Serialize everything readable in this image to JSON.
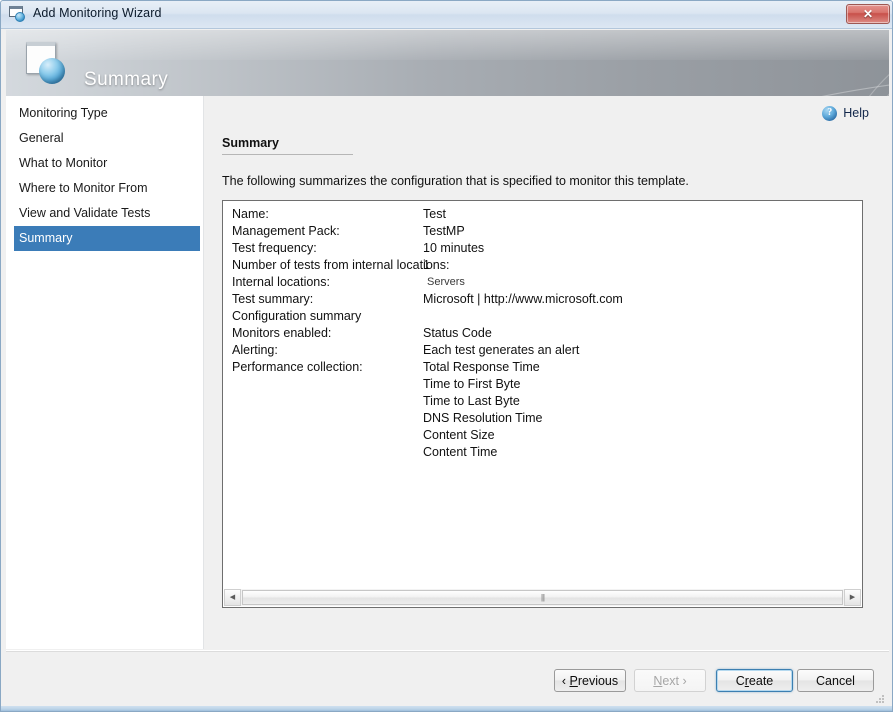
{
  "window": {
    "title": "Add Monitoring Wizard",
    "close_label": "✕",
    "icon": "window-globe-icon"
  },
  "header": {
    "title": "Summary",
    "icon": "page-globe-icon"
  },
  "sidebar": {
    "items": [
      {
        "label": "Monitoring Type",
        "selected": false
      },
      {
        "label": "General",
        "selected": false
      },
      {
        "label": "What to Monitor",
        "selected": false
      },
      {
        "label": "Where to Monitor From",
        "selected": false
      },
      {
        "label": "View and Validate Tests",
        "selected": false
      },
      {
        "label": "Summary",
        "selected": true
      }
    ]
  },
  "content": {
    "help_label": "Help",
    "help_glyph": "?",
    "section_heading": "Summary",
    "intro_text": "The following summarizes the configuration that is specified to monitor this template.",
    "rows": [
      {
        "label": "Name:",
        "value": "Test",
        "small": false
      },
      {
        "label": "Management Pack:",
        "value": "TestMP",
        "small": false
      },
      {
        "label": "Test frequency:",
        "value": "10 minutes",
        "small": false
      },
      {
        "label": "Number of tests from internal locations:",
        "value": "1",
        "small": false
      },
      {
        "label": "Internal locations:",
        "value": "Servers",
        "small": true
      },
      {
        "label": "Test summary:",
        "value": "Microsoft | http://www.microsoft.com",
        "small": false
      },
      {
        "label": "Configuration summary",
        "value": "",
        "small": false
      },
      {
        "label": "Monitors enabled:",
        "value": "Status Code",
        "small": false
      },
      {
        "label": "Alerting:",
        "value": "Each test generates an alert",
        "small": false
      },
      {
        "label": "Performance collection:",
        "value": "Total Response Time",
        "small": false
      },
      {
        "label": "",
        "value": "Time to First Byte",
        "small": false
      },
      {
        "label": "",
        "value": "Time to Last Byte",
        "small": false
      },
      {
        "label": "",
        "value": "DNS Resolution Time",
        "small": false
      },
      {
        "label": "",
        "value": "Content Size",
        "small": false
      },
      {
        "label": "",
        "value": "Content Time",
        "small": false
      }
    ],
    "scrollbar": {
      "left_arrow": "◀",
      "right_arrow": "▶",
      "grip": "|||"
    }
  },
  "footer": {
    "buttons": [
      {
        "name": "previous",
        "prefix": "‹ ",
        "accel": "P",
        "rest": "revious",
        "suffix": "",
        "state": "normal"
      },
      {
        "name": "next",
        "prefix": "",
        "accel": "N",
        "rest": "ext",
        "suffix": " ›",
        "state": "disabled"
      },
      {
        "name": "create",
        "prefix": "C",
        "accel": "r",
        "rest": "eate",
        "suffix": "",
        "state": "default"
      },
      {
        "name": "cancel",
        "prefix": "Cancel",
        "accel": "",
        "rest": "",
        "suffix": "",
        "state": "normal"
      }
    ]
  },
  "colors": {
    "selection_blue": "#3b7cb8",
    "title_bar": "#dbe6f2",
    "panel_bg": "#f0f0f0",
    "default_button_border": "#3c7fb1"
  }
}
